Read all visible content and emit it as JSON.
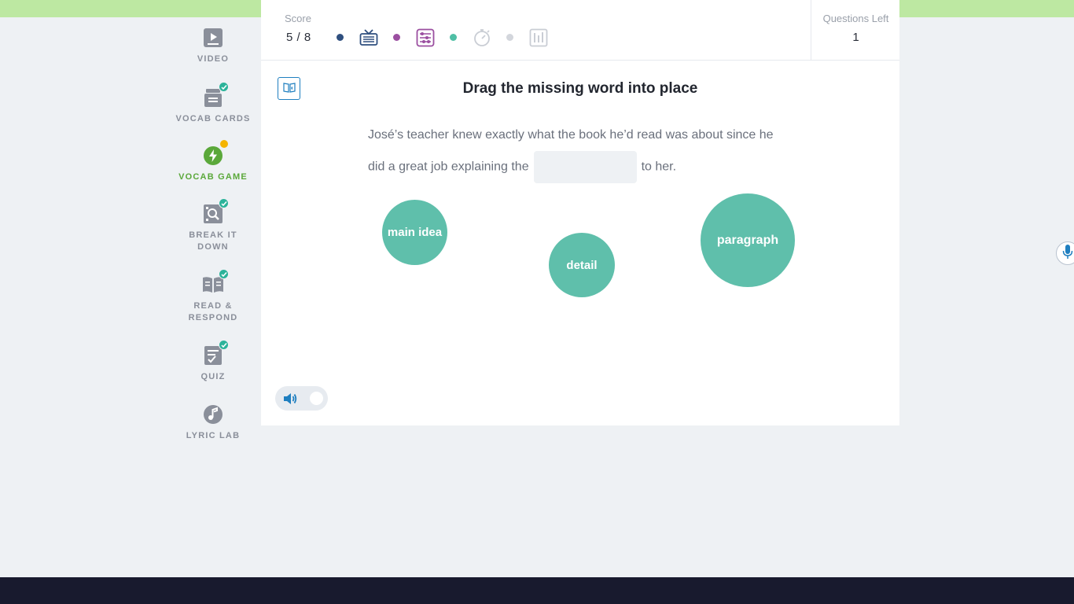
{
  "sidebar": {
    "items": [
      {
        "label": "VIDEO",
        "icon": "video-icon",
        "completed": false,
        "active": false
      },
      {
        "label": "VOCAB CARDS",
        "icon": "vocab-cards-icon",
        "completed": true,
        "active": false
      },
      {
        "label": "VOCAB GAME",
        "icon": "lightning-icon",
        "completed": false,
        "active": true
      },
      {
        "label": "BREAK IT DOWN",
        "icon": "magnifier-grid-icon",
        "completed": true,
        "active": false
      },
      {
        "label": "READ & RESPOND",
        "icon": "open-book-icon",
        "completed": true,
        "active": false
      },
      {
        "label": "QUIZ",
        "icon": "checklist-icon",
        "completed": true,
        "active": false
      },
      {
        "label": "LYRIC LAB",
        "icon": "music-note-icon",
        "completed": false,
        "active": false
      }
    ]
  },
  "header": {
    "score_label": "Score",
    "score_value": "5 / 8",
    "progress": [
      {
        "type": "dot",
        "color": "#2f4f7f"
      },
      {
        "type": "icon",
        "icon": "tv-icon",
        "color": "#2f4f7f"
      },
      {
        "type": "dot",
        "color": "#9b4fa0"
      },
      {
        "type": "icon",
        "icon": "abacus-icon",
        "color": "#9b4fa0"
      },
      {
        "type": "dot",
        "color": "#4fbfa5"
      },
      {
        "type": "icon",
        "icon": "stopwatch-icon",
        "color": "#c9cdd4"
      },
      {
        "type": "dot",
        "color": "#d3d6dc"
      },
      {
        "type": "icon",
        "icon": "bars-icon",
        "color": "#c9cdd4"
      }
    ],
    "questions_left_label": "Questions Left",
    "questions_left_value": "1"
  },
  "question": {
    "title": "Drag the missing word into place",
    "sentence_before": "José’s teacher knew exactly what the book he’d read was about since he did a great job explaining the",
    "sentence_after": "to her."
  },
  "choices": [
    {
      "label": "main idea"
    },
    {
      "label": "detail"
    },
    {
      "label": "paragraph"
    }
  ],
  "colors": {
    "accent_green": "#5aa83a",
    "bubble": "#5fbfab",
    "badge_check": "#2cb39a",
    "badge_new": "#f5b400",
    "audio_blue": "#1f7fc0"
  }
}
